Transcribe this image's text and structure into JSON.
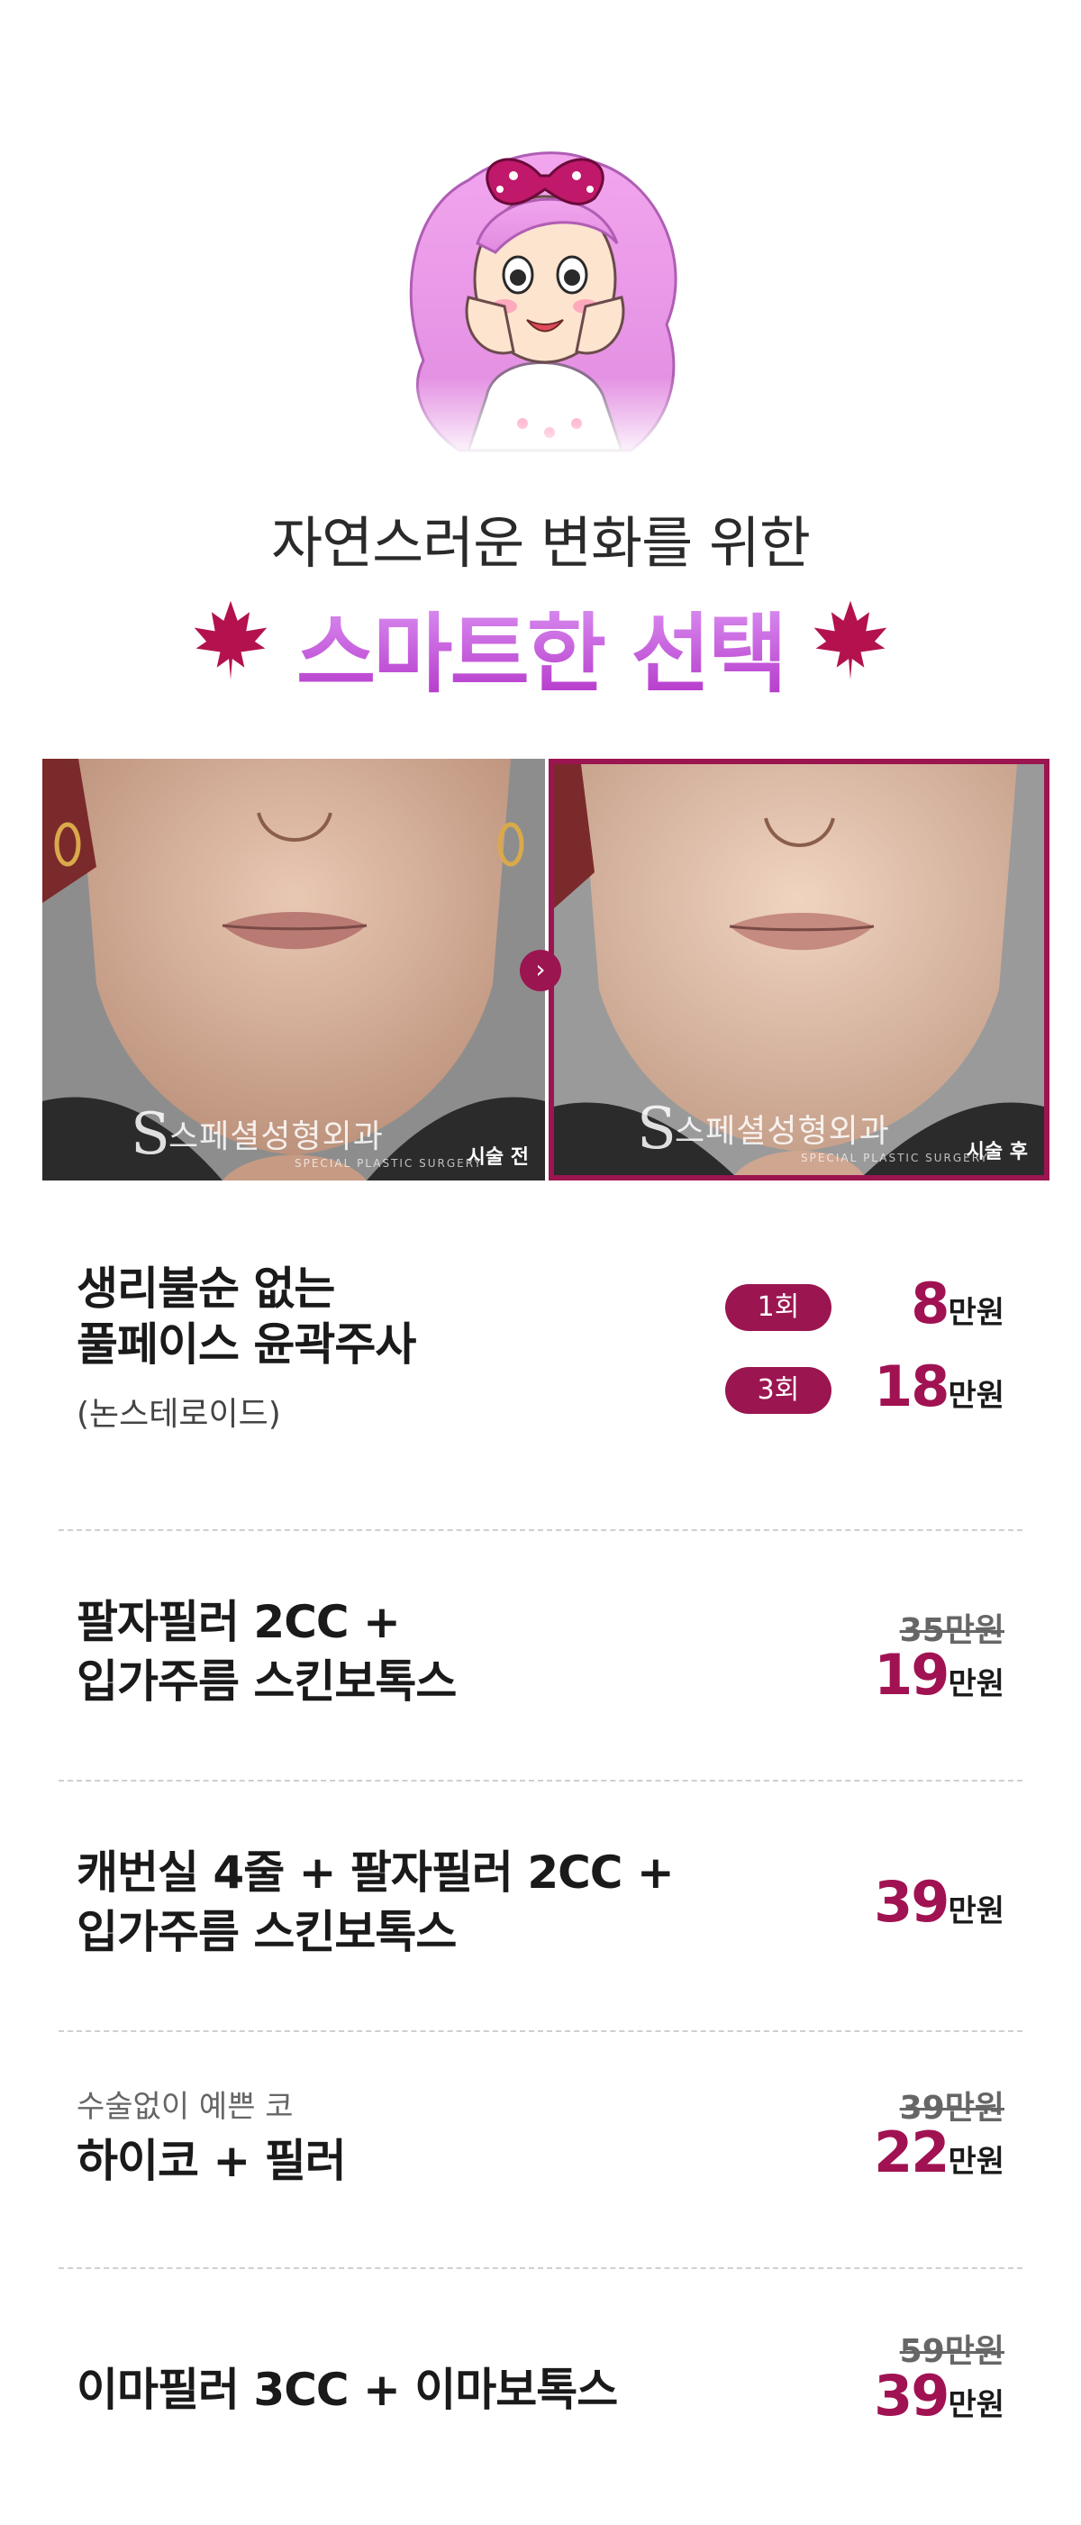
{
  "header": {
    "subtitle": "자연스러운 변화를 위한",
    "title": "스마트한 선택"
  },
  "photos": {
    "before_label": "시술 전",
    "after_label": "시술 후",
    "watermark": "스페셜성형외과",
    "watermark_sub": "SPECIAL PLASTIC SURGERY"
  },
  "items": [
    {
      "line1": "생리불순 없는",
      "line2": "풀페이스 윤곽주사",
      "note": "(논스테로이드)",
      "options": [
        {
          "badge": "1회",
          "price": "8",
          "unit": "만원"
        },
        {
          "badge": "3회",
          "price": "18",
          "unit": "만원"
        }
      ]
    },
    {
      "line1": "팔자필러 2CC +",
      "line2": "입가주름 스킨보톡스",
      "old_price": "35만원",
      "price": "19",
      "unit": "만원"
    },
    {
      "line1": "캐번실 4줄 + 팔자필러 2CC +",
      "line2": "입가주름 스킨보톡스",
      "price": "39",
      "unit": "만원"
    },
    {
      "caption": "수술없이 예쁜 코",
      "line1": "하이코 + 필러",
      "old_price": "39만원",
      "price": "22",
      "unit": "만원"
    },
    {
      "line1": "이마필러 3CC + 이마보톡스",
      "old_price": "59만원",
      "price": "39",
      "unit": "만원"
    }
  ],
  "colors": {
    "accent": "#9b1550",
    "title_purple": "#c04dcf"
  }
}
